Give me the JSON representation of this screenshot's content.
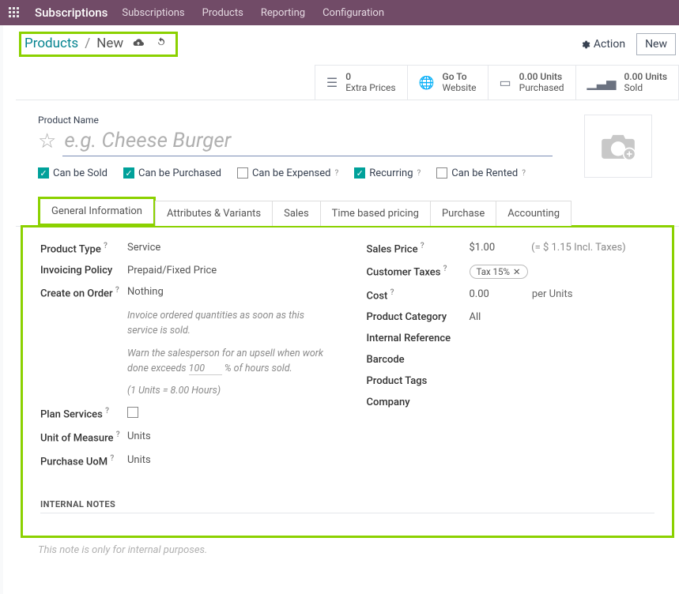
{
  "topbar": {
    "app": "Subscriptions",
    "menu": [
      "Subscriptions",
      "Products",
      "Reporting",
      "Configuration"
    ]
  },
  "breadcrumb": {
    "root": "Products",
    "sep": "/",
    "current": "New"
  },
  "actions": {
    "action": "Action",
    "new": "New"
  },
  "stats": {
    "extra": {
      "n": "0",
      "l": "Extra Prices"
    },
    "goto": {
      "n": "Go To",
      "l": "Website"
    },
    "purchased": {
      "n": "0.00 Units",
      "l": "Purchased"
    },
    "sold": {
      "n": "0.00 Units",
      "l": "Sold"
    }
  },
  "form": {
    "name_label": "Product Name",
    "name_ph": "e.g. Cheese Burger",
    "checks": {
      "sold": "Can be Sold",
      "purchased": "Can be Purchased",
      "expensed": "Can be Expensed",
      "recurring": "Recurring",
      "rented": "Can be Rented"
    }
  },
  "tabs": [
    "General Information",
    "Attributes & Variants",
    "Sales",
    "Time based pricing",
    "Purchase",
    "Accounting"
  ],
  "gi": {
    "left": {
      "ptype_l": "Product Type",
      "ptype_v": "Service",
      "ipolicy_l": "Invoicing Policy",
      "ipolicy_v": "Prepaid/Fixed Price",
      "coo_l": "Create on Order",
      "coo_v": "Nothing",
      "help1": "Invoice ordered quantities as soon as this service is sold.",
      "help2a": "Warn the salesperson for an upsell when work done exceeds",
      "help2_pct": "100",
      "help2b": "% of hours sold.",
      "help3": "(1 Units = 8.00 Hours)",
      "plan_l": "Plan Services",
      "uom_l": "Unit of Measure",
      "uom_v": "Units",
      "puom_l": "Purchase UoM",
      "puom_v": "Units"
    },
    "right": {
      "sp_l": "Sales Price",
      "sp_v": "$1.00",
      "sp_incl": "(= $ 1.15 Incl. Taxes)",
      "ct_l": "Customer Taxes",
      "ct_tag": "Tax 15%",
      "cost_l": "Cost",
      "cost_v": "0.00",
      "cost_per": "per Units",
      "cat_l": "Product Category",
      "cat_v": "All",
      "iref_l": "Internal Reference",
      "bar_l": "Barcode",
      "tags_l": "Product Tags",
      "comp_l": "Company"
    },
    "notes_h": "INTERNAL NOTES",
    "notes_ph": "This note is only for internal purposes."
  }
}
